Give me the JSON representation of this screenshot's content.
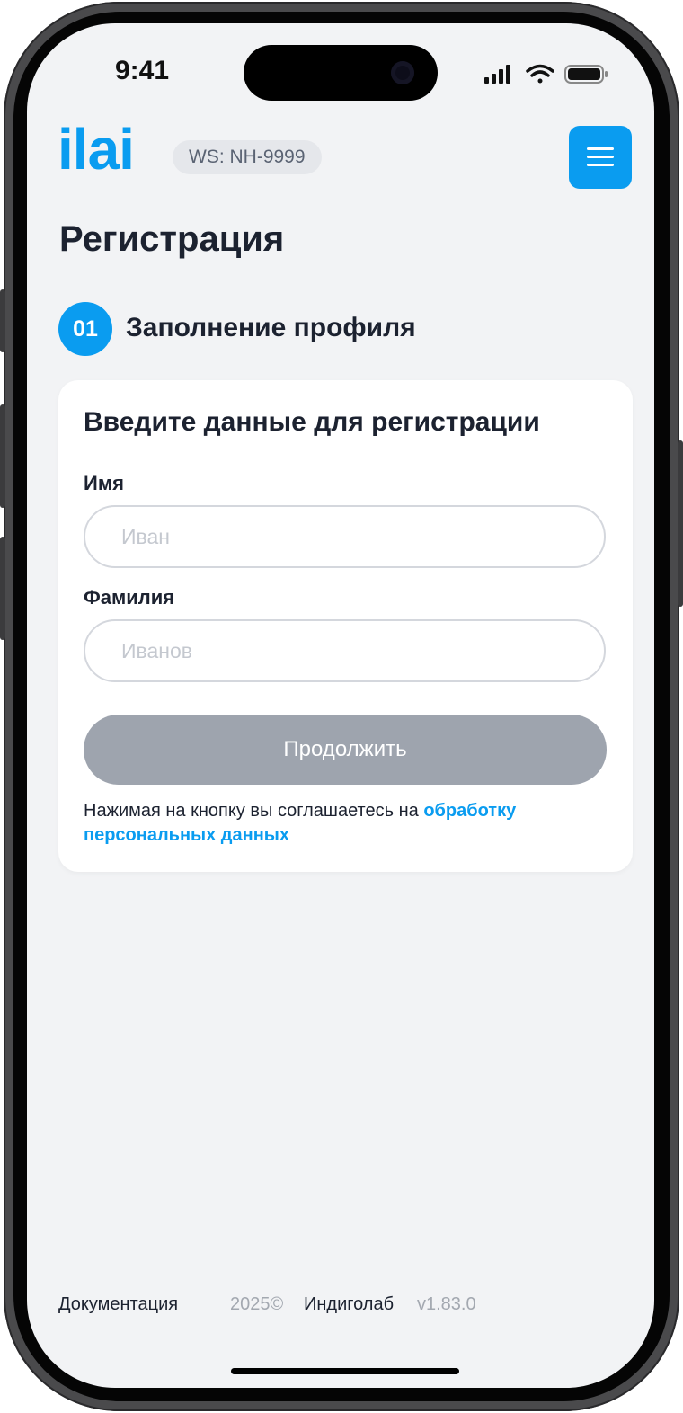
{
  "status_bar": {
    "time": "9:41"
  },
  "header": {
    "logo_text": "ilai",
    "ws_badge": "WS: NH-9999"
  },
  "page": {
    "title": "Регистрация",
    "step": {
      "number": "01",
      "label": "Заполнение профиля"
    }
  },
  "form": {
    "title": "Введите данные для регистрации",
    "first_name": {
      "label": "Имя",
      "placeholder": "Иван",
      "value": ""
    },
    "last_name": {
      "label": "Фамилия",
      "placeholder": "Иванов",
      "value": ""
    },
    "submit_label": "Продолжить",
    "consent_text": "Нажимая на кнопку вы соглашаетесь на ",
    "consent_link": "обработку персональных данных"
  },
  "footer": {
    "docs_link": "Документация",
    "year": "2025©",
    "company": "Индиголаб",
    "version": "v1.83.0"
  },
  "colors": {
    "accent": "#0a9cf0",
    "background": "#f2f3f5",
    "disabled_button": "#9ea4ae",
    "text": "#1c2230"
  },
  "icons": [
    "signal-icon",
    "wifi-icon",
    "battery-icon",
    "menu-icon"
  ]
}
